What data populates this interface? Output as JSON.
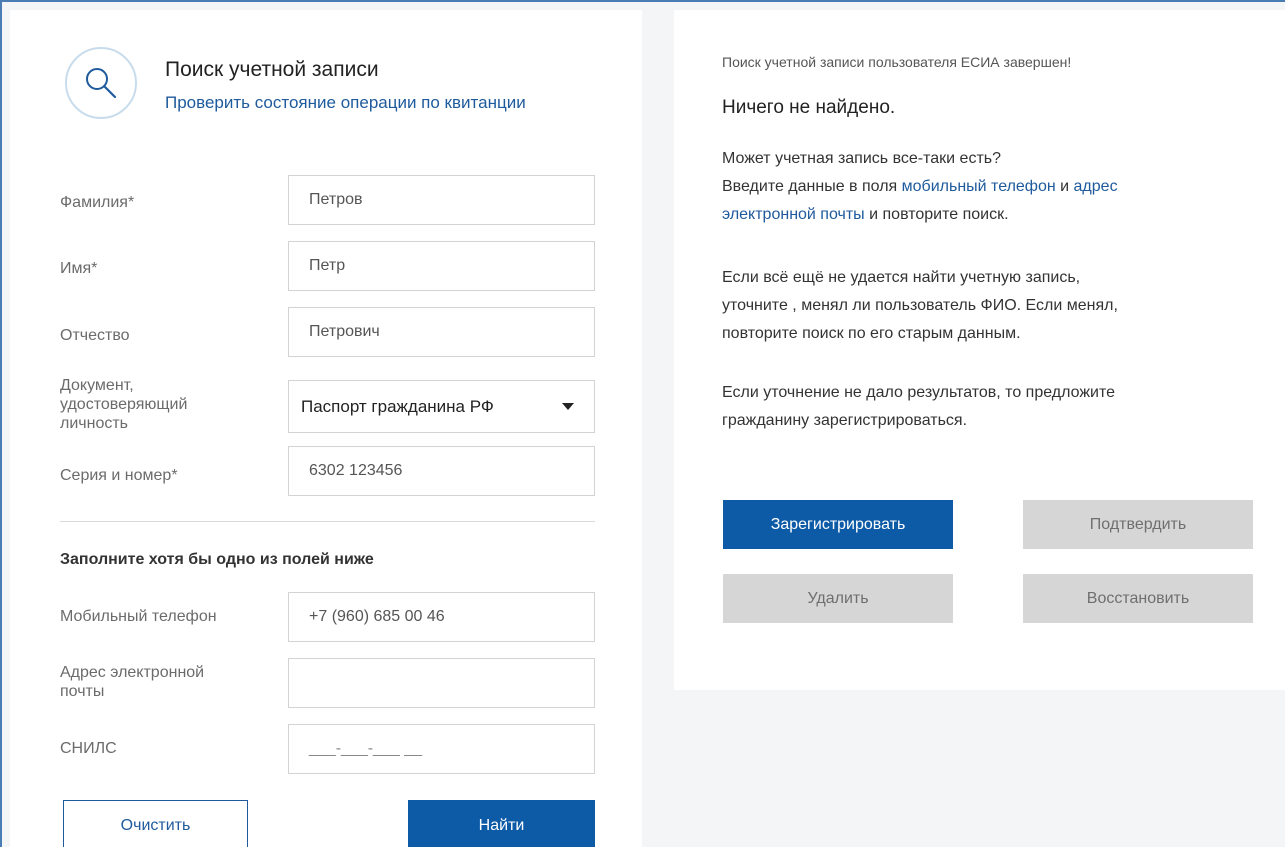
{
  "header": {
    "title": "Поиск учетной записи",
    "check_link": "Проверить состояние операции по квитанции",
    "icon": "search-icon"
  },
  "form": {
    "surname": {
      "label": "Фамилия*",
      "value": "Петров"
    },
    "name": {
      "label": "Имя*",
      "value": "Петр"
    },
    "patronymic": {
      "label": "Отчество",
      "value": "Петрович"
    },
    "document": {
      "label_lines": [
        "Документ,",
        "удостоверяющий",
        "личность"
      ],
      "value": "Паспорт гражданина РФ"
    },
    "series": {
      "label": "Серия и номер*",
      "value": "6302 123456"
    },
    "subtitle": "Заполните хотя бы одно из полей ниже",
    "phone": {
      "label": "Мобильный телефон",
      "value": "+7 (960) 685 00 46"
    },
    "email": {
      "label_lines": [
        "Адрес электронной",
        "почты"
      ],
      "value": ""
    },
    "snils": {
      "label": "СНИЛС",
      "placeholder": "___-___-___ __"
    },
    "clear_button": "Очистить",
    "find_button": "Найти"
  },
  "result": {
    "status": "Поиск учетной записи пользователя ЕСИА завершен!",
    "heading": "Ничего не найдено.",
    "p1_line1": "Может учетная запись все-таки есть?",
    "p1_pre": "Введите данные в поля ",
    "p1_link1": "мобильный телефон",
    "p1_and": " и ",
    "p1_link2a": "адрес",
    "p1_link2b": "электронной почты",
    "p1_post": " и повторите поиск.",
    "p2": [
      "Если всё ещё не удается найти учетную запись,",
      "уточните , менял ли пользователь ФИО. Если менял,",
      "повторите поиск по его старым данным."
    ],
    "p3": [
      "Если уточнение не дало результатов, то предложите",
      "гражданину зарегистрироваться."
    ],
    "buttons": {
      "register": "Зарегистрировать",
      "confirm": "Подтвердить",
      "delete": "Удалить",
      "restore": "Восстановить"
    }
  },
  "colors": {
    "primary": "#0d5aa7",
    "link": "#1e5a9c",
    "disabled": "#d6d6d6"
  }
}
